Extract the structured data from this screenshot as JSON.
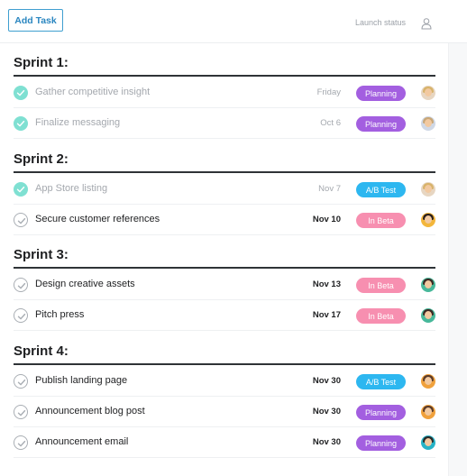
{
  "toolbar": {
    "add_task_label": "Add Task",
    "launch_status_label": "Launch status",
    "user_icon": "person-icon"
  },
  "colors": {
    "planning": "#a35fe0",
    "ab_test": "#2db7f0",
    "in_beta": "#f78fb0",
    "check_done": "#7fe0d2"
  },
  "sprints": [
    {
      "title": "Sprint 1:",
      "tasks": [
        {
          "name": "Gather competitive insight",
          "date": "Friday",
          "status": "Planning",
          "done": true,
          "avatar": "avatar-blonde"
        },
        {
          "name": "Finalize messaging",
          "date": "Oct 6",
          "status": "Planning",
          "done": true,
          "avatar": "avatar-blue"
        }
      ]
    },
    {
      "title": "Sprint 2:",
      "tasks": [
        {
          "name": "App Store listing",
          "date": "Nov 7",
          "status": "A/B Test",
          "done": true,
          "avatar": "avatar-blonde"
        },
        {
          "name": "Secure customer references",
          "date": "Nov 10",
          "status": "In Beta",
          "done": false,
          "avatar": "avatar-dark"
        }
      ]
    },
    {
      "title": "Sprint 3:",
      "tasks": [
        {
          "name": "Design creative assets",
          "date": "Nov 13",
          "status": "In Beta",
          "done": false,
          "avatar": "avatar-teal"
        },
        {
          "name": "Pitch press",
          "date": "Nov 17",
          "status": "In Beta",
          "done": false,
          "avatar": "avatar-teal"
        }
      ]
    },
    {
      "title": "Sprint 4:",
      "tasks": [
        {
          "name": "Publish landing page",
          "date": "Nov 30",
          "status": "A/B Test",
          "done": false,
          "avatar": "avatar-orange"
        },
        {
          "name": "Announcement blog post",
          "date": "Nov 30",
          "status": "Planning",
          "done": false,
          "avatar": "avatar-orange"
        },
        {
          "name": "Announcement email",
          "date": "Nov 30",
          "status": "Planning",
          "done": false,
          "avatar": "avatar-cyan"
        }
      ]
    }
  ]
}
